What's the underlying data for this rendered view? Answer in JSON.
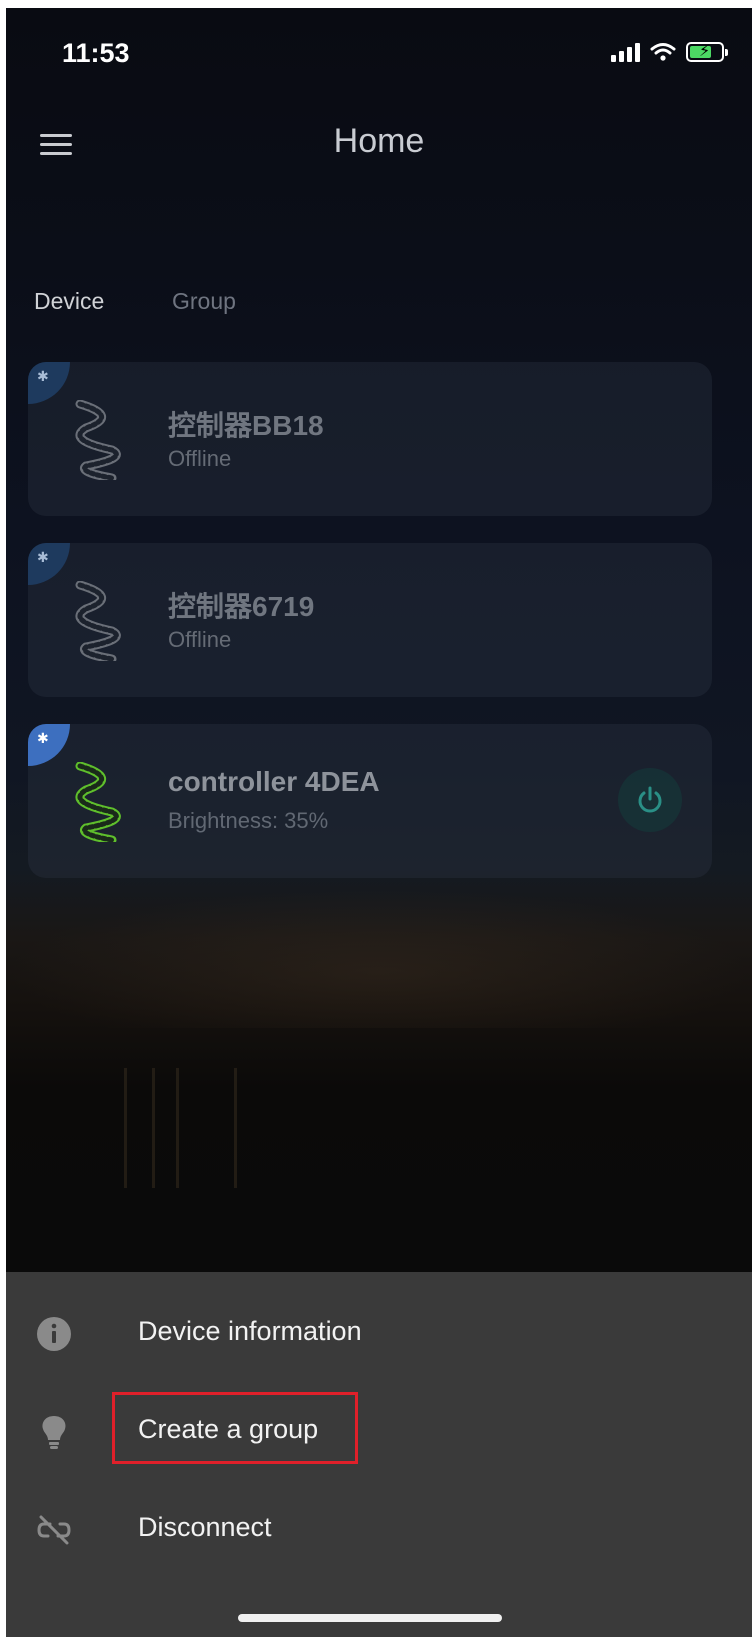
{
  "status_bar": {
    "time": "11:53"
  },
  "header": {
    "title": "Home",
    "menu_icon": "hamburger-menu-icon"
  },
  "tabs": [
    {
      "label": "Device",
      "active": true
    },
    {
      "label": "Group",
      "active": false
    }
  ],
  "devices": [
    {
      "name": "控制器BB18",
      "status": "Offline",
      "icon": "led-strip-icon",
      "connection_icon": "bluetooth-icon"
    },
    {
      "name": "控制器6719",
      "status": "Offline",
      "icon": "led-strip-icon",
      "connection_icon": "bluetooth-icon"
    },
    {
      "name": "controller 4DEA",
      "status": "Brightness: 35%",
      "icon": "led-strip-icon",
      "connection_icon": "bluetooth-icon",
      "power_icon": "power-icon"
    }
  ],
  "action_sheet": {
    "items": [
      {
        "label": "Device information",
        "icon": "info-icon"
      },
      {
        "label": "Create a group",
        "icon": "lightbulb-icon"
      },
      {
        "label": "Disconnect",
        "icon": "unlink-icon"
      }
    ]
  },
  "colors": {
    "accent_green": "#5fbf2c",
    "bluetooth_active": "#3d6fbf",
    "highlight_red": "#e0202a",
    "sheet_background": "#3a3a3a"
  }
}
